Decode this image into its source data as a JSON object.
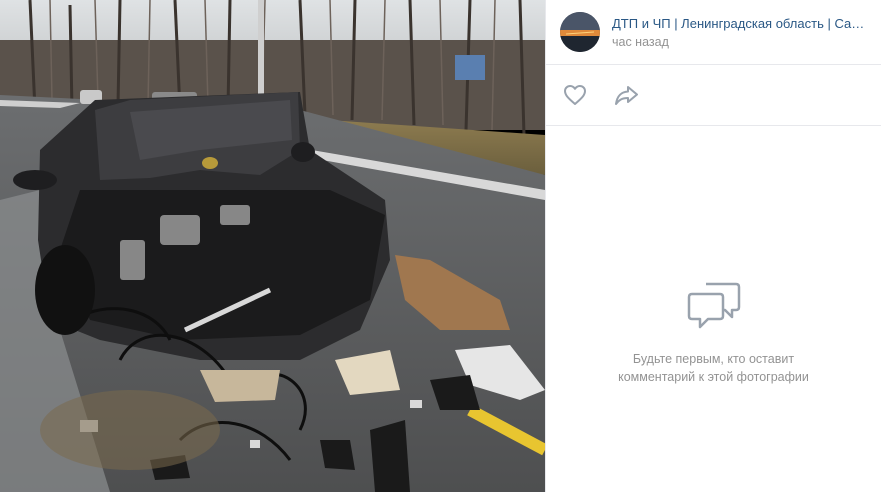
{
  "post": {
    "author": "ДТП и ЧП | Ленинградская область | Санкт-Петербург",
    "time": "час назад"
  },
  "actions": {
    "like_icon": "heart-icon",
    "share_icon": "share-icon"
  },
  "comments": {
    "empty_icon": "comments-icon",
    "empty_text": "Будьте первым, кто оставит комментарий к этой фотографии"
  },
  "colors": {
    "link": "#2a5885",
    "muted": "#939393",
    "icon": "#99a2ad",
    "divider": "#e7e8ec"
  }
}
